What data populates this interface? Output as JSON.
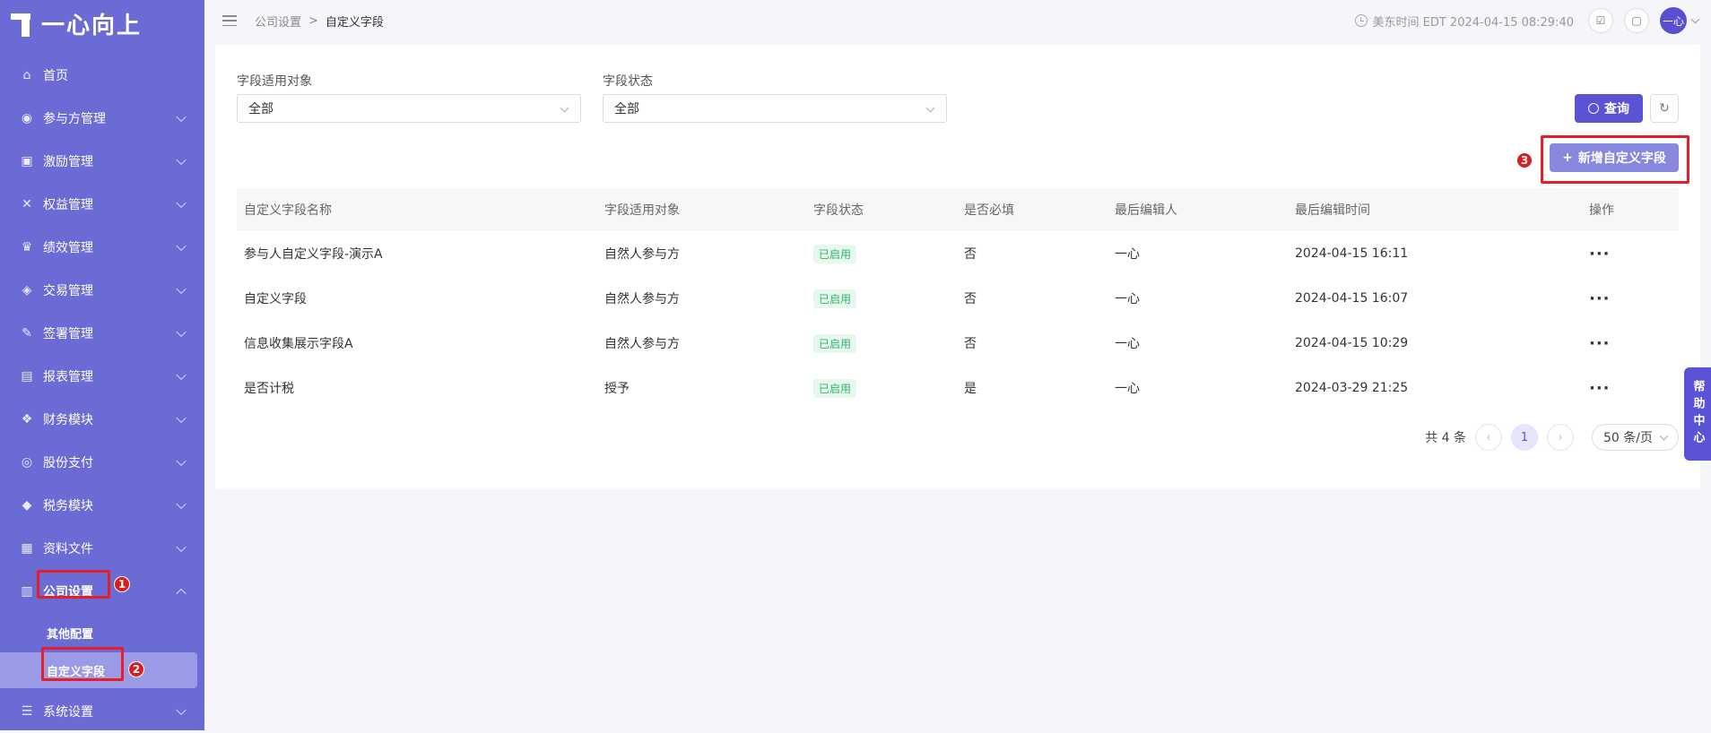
{
  "brand": {
    "name": "一心向上"
  },
  "sidebar": {
    "items": [
      {
        "label": "首页",
        "icon": "home-icon",
        "glyph": "⌂"
      },
      {
        "label": "参与方管理",
        "icon": "participants-icon",
        "glyph": "◉"
      },
      {
        "label": "激励管理",
        "icon": "incentive-icon",
        "glyph": "▣"
      },
      {
        "label": "权益管理",
        "icon": "equity-icon",
        "glyph": "✕"
      },
      {
        "label": "绩效管理",
        "icon": "performance-icon",
        "glyph": "♛"
      },
      {
        "label": "交易管理",
        "icon": "trade-icon",
        "glyph": "◈"
      },
      {
        "label": "签署管理",
        "icon": "sign-icon",
        "glyph": "✎"
      },
      {
        "label": "报表管理",
        "icon": "report-icon",
        "glyph": "▤"
      },
      {
        "label": "财务模块",
        "icon": "finance-icon",
        "glyph": "❖"
      },
      {
        "label": "股份支付",
        "icon": "share-payment-icon",
        "glyph": "◎"
      },
      {
        "label": "税务模块",
        "icon": "tax-icon",
        "glyph": "◆"
      },
      {
        "label": "资料文件",
        "icon": "files-icon",
        "glyph": "▦"
      },
      {
        "label": "公司设置",
        "icon": "company-settings-icon",
        "glyph": "▥"
      }
    ],
    "sub_items": [
      {
        "label": "其他配置"
      },
      {
        "label": "自定义字段"
      }
    ],
    "bottom_item": {
      "label": "系统设置",
      "icon": "system-settings-icon",
      "glyph": "☰"
    }
  },
  "annotations": {
    "step1": "1",
    "step2": "2",
    "step3": "3"
  },
  "header": {
    "breadcrumb_parent": "公司设置",
    "breadcrumb_sep": ">",
    "breadcrumb_current": "自定义字段",
    "timezone_text": "美东时间 EDT 2024-04-15 08:29:40",
    "avatar_text": "一心"
  },
  "filters": {
    "target_label": "字段适用对象",
    "target_value": "全部",
    "status_label": "字段状态",
    "status_value": "全部",
    "search_button": "查询",
    "refresh_glyph": "↻"
  },
  "add_button": {
    "plus": "+",
    "label": "新增自定义字段"
  },
  "table": {
    "headers": [
      "自定义字段名称",
      "字段适用对象",
      "字段状态",
      "是否必填",
      "最后编辑人",
      "最后编辑时间",
      "操作"
    ],
    "rows": [
      [
        "参与人自定义字段-演示A",
        "自然人参与方",
        "已启用",
        "否",
        "一心",
        "2024-04-15 16:11",
        "···"
      ],
      [
        "自定义字段",
        "自然人参与方",
        "已启用",
        "否",
        "一心",
        "2024-04-15 16:07",
        "···"
      ],
      [
        "信息收集展示字段A",
        "自然人参与方",
        "已启用",
        "否",
        "一心",
        "2024-04-15 10:29",
        "···"
      ],
      [
        "是否计税",
        "授予",
        "已启用",
        "是",
        "一心",
        "2024-03-29 21:25",
        "···"
      ]
    ]
  },
  "pagination": {
    "total_text": "共 4 条",
    "prev": "‹",
    "current_page": "1",
    "next": "›",
    "page_size": "50 条/页"
  },
  "help": {
    "label": "帮助中心"
  },
  "colors": {
    "sidebar_bg": "#6b6bd6",
    "primary": "#5b53d6",
    "status_green": "#2eb46a",
    "annotation_red": "#e61e28"
  }
}
